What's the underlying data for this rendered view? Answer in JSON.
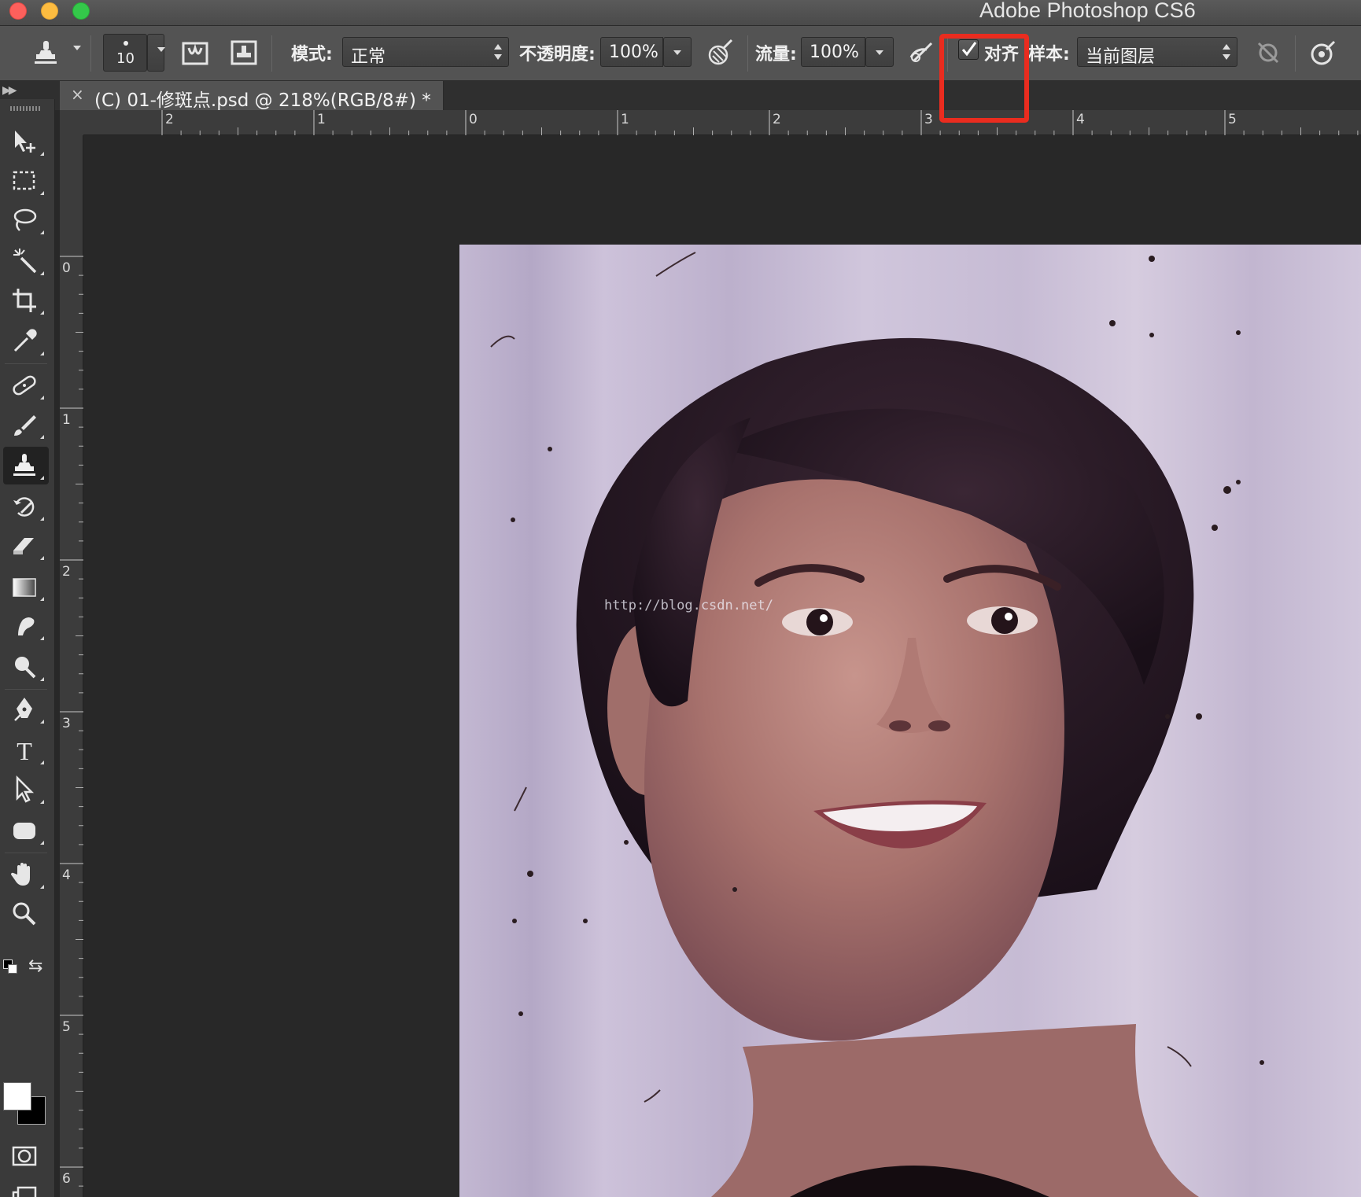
{
  "window": {
    "title": "Adobe Photoshop CS6",
    "traffic_lights": {
      "close": "#fc605c",
      "minimize": "#fdbc40",
      "maximize": "#34c84a"
    }
  },
  "options_bar": {
    "tool_icon": "clone-stamp-icon",
    "brush_size": "10",
    "mode_label": "模式:",
    "mode_value": "正常",
    "opacity_label": "不透明度:",
    "opacity_value": "100%",
    "flow_label": "流量:",
    "flow_value": "100%",
    "aligned_checked": true,
    "aligned_label": "对齐",
    "sample_label": "样本:",
    "sample_value": "当前图层",
    "highlight_color": "#ea2c1f"
  },
  "document": {
    "tab_close": "×",
    "tab_title": "(C) 01-修斑点.psd @ 218%(RGB/8#) *",
    "zoom": "218%"
  },
  "rulers": {
    "top_labels": [
      "2",
      "1",
      "0",
      "1",
      "2",
      "3",
      "4",
      "5"
    ],
    "left_labels": [
      "0",
      "1",
      "2",
      "3",
      "4",
      "5",
      "6"
    ]
  },
  "toolbox": {
    "tools": [
      "move-tool",
      "marquee-tool",
      "lasso-tool",
      "magic-wand-tool",
      "crop-tool",
      "eyedropper-tool",
      "healing-brush-tool",
      "brush-tool",
      "clone-stamp-tool",
      "history-brush-tool",
      "eraser-tool",
      "gradient-tool",
      "smudge-tool",
      "dodge-tool",
      "pen-tool",
      "type-tool",
      "path-selection-tool",
      "shape-tool",
      "hand-tool",
      "zoom-tool"
    ],
    "active_tool": "clone-stamp-tool",
    "foreground_color": "#ffffff",
    "background_color": "#000000"
  },
  "canvas": {
    "watermark": "http://blog.csdn.net/"
  }
}
